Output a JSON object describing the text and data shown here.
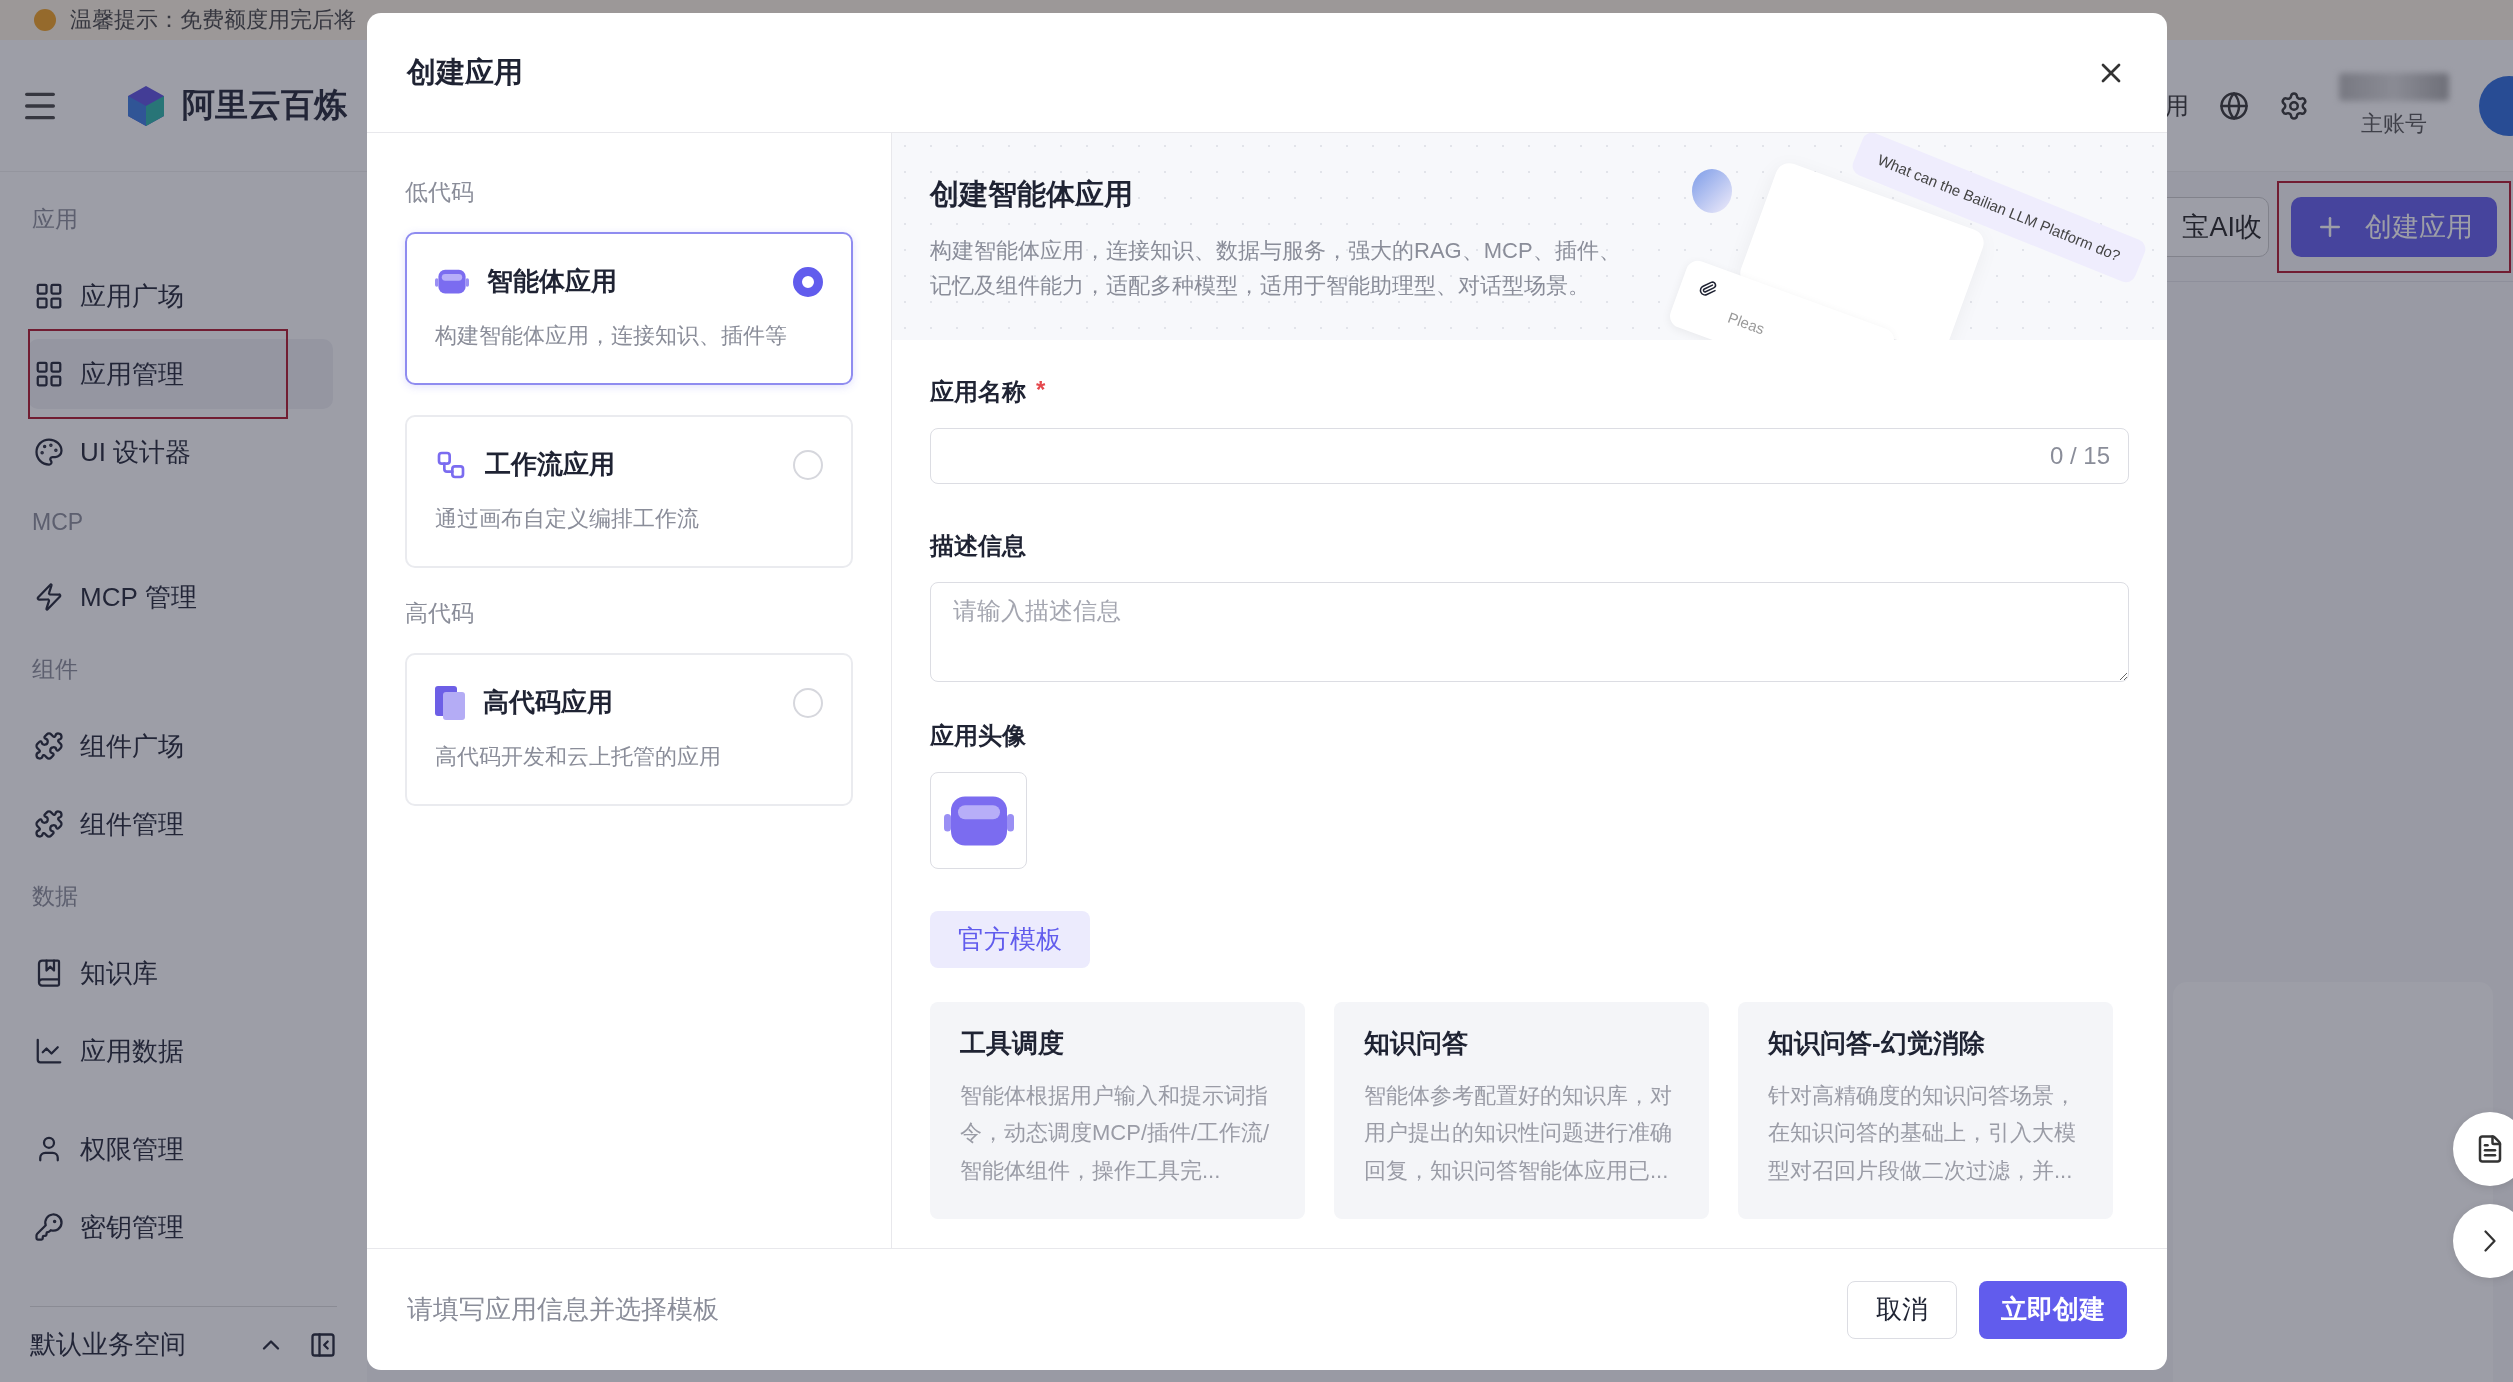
{
  "notice": {
    "text": "温馨提示：免费额度用完后将"
  },
  "header": {
    "logo_text": "阿里云百炼",
    "cut_text": "用",
    "account_label": "主账号"
  },
  "sidebar": {
    "sections": [
      {
        "title": "应用",
        "items": [
          {
            "label": "应用广场",
            "selected": false,
            "highlighted": false
          },
          {
            "label": "应用管理",
            "selected": true,
            "highlighted": true
          },
          {
            "label": "UI 设计器",
            "selected": false,
            "highlighted": false
          }
        ]
      },
      {
        "title": "MCP",
        "items": [
          {
            "label": "MCP 管理",
            "selected": false,
            "highlighted": false
          }
        ]
      },
      {
        "title": "组件",
        "items": [
          {
            "label": "组件广场",
            "selected": false,
            "highlighted": false
          },
          {
            "label": "组件管理",
            "selected": false,
            "highlighted": false
          }
        ]
      },
      {
        "title": "数据",
        "items": [
          {
            "label": "知识库",
            "selected": false,
            "highlighted": false
          },
          {
            "label": "应用数据",
            "selected": false,
            "highlighted": false
          }
        ]
      },
      {
        "items": [
          {
            "label": "权限管理",
            "selected": false,
            "highlighted": false
          },
          {
            "label": "密钥管理",
            "selected": false,
            "highlighted": false
          }
        ]
      }
    ],
    "workspace": "默认业务空间"
  },
  "toolbar": {
    "cut_button": "宝AI收",
    "create_button": {
      "label": "创建应用",
      "highlighted": true
    }
  },
  "modal": {
    "title": "创建应用",
    "type_groups": [
      {
        "title": "低代码",
        "items": [
          {
            "kind": "agent",
            "title": "智能体应用",
            "description": "构建智能体应用，连接知识、插件等",
            "selected": true
          },
          {
            "kind": "workflow",
            "title": "工作流应用",
            "description": "通过画布自定义编排工作流",
            "selected": false
          }
        ]
      },
      {
        "title": "高代码",
        "items": [
          {
            "kind": "code",
            "title": "高代码应用",
            "description": "高代码开发和云上托管的应用",
            "selected": false
          }
        ]
      }
    ],
    "hero": {
      "title": "创建智能体应用",
      "description": "构建智能体应用，连接知识、数据与服务，强大的RAG、MCP、插件、记忆及组件能力，适配多种模型，适用于智能助理型、对话型场景。",
      "bubble_text": "What can the Bailian LLM Platform do?",
      "input_hint": "Pleas"
    },
    "form": {
      "name_label": "应用名称",
      "name_required_mark": "*",
      "name_counter": "0 / 15",
      "description_label": "描述信息",
      "description_placeholder": "请输入描述信息",
      "avatar_label": "应用头像"
    },
    "template_tab": "官方模板",
    "templates": [
      {
        "title": "工具调度",
        "description": "智能体根据用户输入和提示词指令，动态调度MCP/插件/工作流/智能体组件，操作工具完..."
      },
      {
        "title": "知识问答",
        "description": "智能体参考配置好的知识库，对用户提出的知识性问题进行准确回复，知识问答智能体应用已..."
      },
      {
        "title": "知识问答-幻觉消除",
        "description": "针对高精确度的知识问答场景，在知识问答的基础上，引入大模型对召回片段做二次过滤，并..."
      }
    ],
    "footer_hint": "请填写应用信息并选择模板",
    "cancel_button": "取消",
    "submit_button": "立即创建"
  }
}
